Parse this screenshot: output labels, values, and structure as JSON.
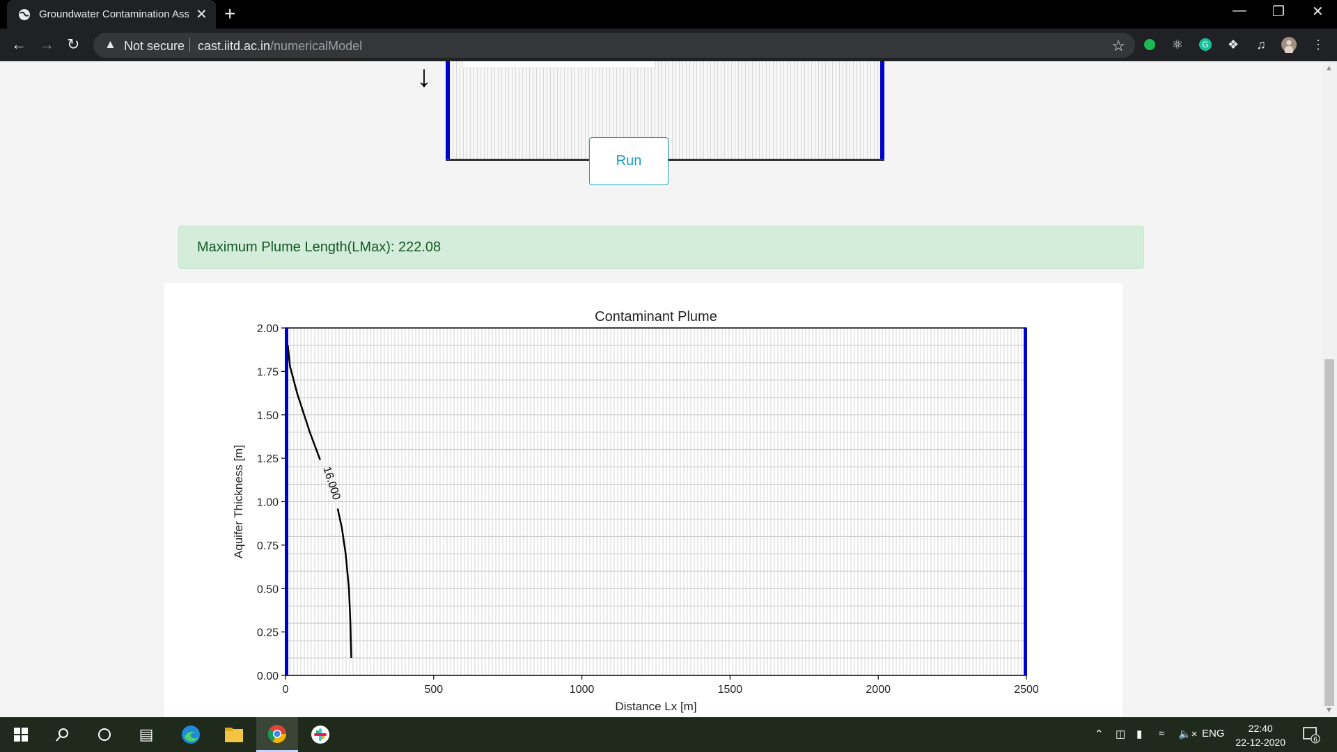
{
  "browser": {
    "tab_title": "Groundwater Contamination Ass",
    "tab_close": "✕",
    "new_tab": "+",
    "not_secure": "Not secure",
    "url_host": "cast.iitd.ac.in",
    "url_path": "/numericalModel"
  },
  "page": {
    "run_label": "Run",
    "result_text": "Maximum Plume Length(LMax): 222.08"
  },
  "chart_data": {
    "type": "line",
    "title": "Contaminant Plume",
    "xlabel": "Distance Lx [m]",
    "ylabel": "Aquifer Thickness [m]",
    "xlim": [
      0,
      2500
    ],
    "ylim": [
      0,
      2.0
    ],
    "xticks": [
      0,
      500,
      1000,
      1500,
      2000,
      2500
    ],
    "yticks": [
      0.0,
      0.25,
      0.5,
      0.75,
      1.0,
      1.25,
      1.5,
      1.75,
      2.0
    ],
    "ytick_labels": [
      "0.00",
      "0.25",
      "0.50",
      "0.75",
      "1.00",
      "1.25",
      "1.50",
      "1.75",
      "2.00"
    ],
    "contour_label": "16.000",
    "contour": [
      {
        "x": 222,
        "y": 0.1
      },
      {
        "x": 219,
        "y": 0.3
      },
      {
        "x": 214,
        "y": 0.5
      },
      {
        "x": 203,
        "y": 0.7
      },
      {
        "x": 190,
        "y": 0.85
      },
      {
        "x": 176,
        "y": 0.96
      },
      {
        "x": 117,
        "y": 1.24
      },
      {
        "x": 82,
        "y": 1.4
      },
      {
        "x": 40,
        "y": 1.62
      },
      {
        "x": 15,
        "y": 1.78
      },
      {
        "x": 8,
        "y": 1.9
      }
    ],
    "boundary_color": "#0000cc",
    "grid": true
  },
  "taskbar": {
    "language": "ENG",
    "time": "22:40",
    "date": "22-12-2020",
    "notifications": "6"
  }
}
